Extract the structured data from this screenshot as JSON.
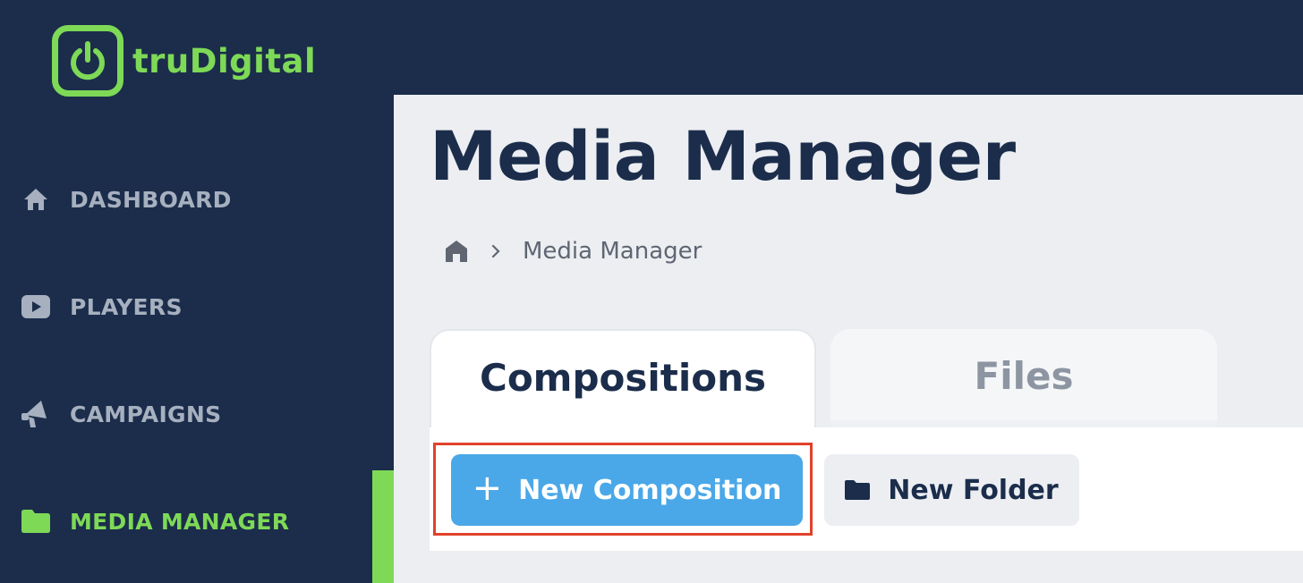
{
  "app": {
    "brand": "truDigital"
  },
  "colors": {
    "sidebar": "#1b2d4b",
    "accent": "#7ed957",
    "primary_button": "#4aa8e8",
    "highlight": "#e1412b"
  },
  "sidebar": {
    "items": [
      {
        "label": "DASHBOARD",
        "icon": "home-icon",
        "active": false
      },
      {
        "label": "PLAYERS",
        "icon": "play-icon",
        "active": false
      },
      {
        "label": "CAMPAIGNS",
        "icon": "megaphone-icon",
        "active": false
      },
      {
        "label": "MEDIA MANAGER",
        "icon": "folder-icon",
        "active": true
      }
    ]
  },
  "page": {
    "title": "Media Manager",
    "breadcrumb": {
      "home_icon": "home-icon",
      "current": "Media Manager"
    }
  },
  "tabs": [
    {
      "label": "Compositions",
      "active": true
    },
    {
      "label": "Files",
      "active": false
    }
  ],
  "toolbar": {
    "new_composition_label": "New Composition",
    "new_composition_icon": "+",
    "new_folder_label": "New Folder"
  }
}
